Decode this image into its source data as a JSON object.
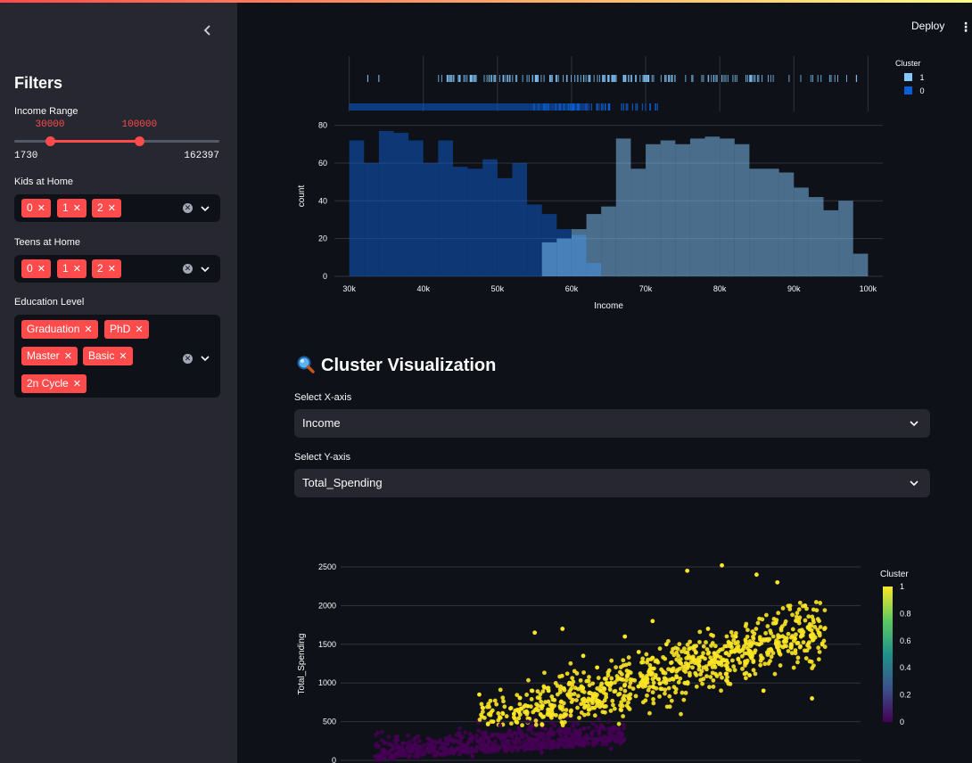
{
  "app": {
    "deploy_label": "Deploy",
    "menu_icon": "kebab-menu-icon"
  },
  "sidebar": {
    "collapse_icon": "chevron-left-icon",
    "title": "Filters",
    "income_range": {
      "label": "Income Range",
      "low": "30000",
      "high": "100000",
      "min": "1730",
      "max": "162397",
      "low_frac": 0.174,
      "high_frac": 0.61
    },
    "kids": {
      "label": "Kids at Home",
      "tags": [
        "0",
        "1",
        "2"
      ]
    },
    "teens": {
      "label": "Teens at Home",
      "tags": [
        "0",
        "1",
        "2"
      ]
    },
    "education": {
      "label": "Education Level",
      "tags": [
        "Graduation",
        "PhD",
        "Master",
        "Basic",
        "2n Cycle"
      ]
    }
  },
  "main": {
    "section_title": "Cluster Visualization",
    "section_icon": "magnifier-icon",
    "x_select": {
      "label": "Select X-axis",
      "value": "Income"
    },
    "y_select": {
      "label": "Select Y-axis",
      "value": "Total_Spending"
    }
  },
  "colors": {
    "accent": "#ff4b4b",
    "cluster0": "#0b5fd4",
    "cluster1": "#83c9ff"
  },
  "chart_data": [
    {
      "type": "bar",
      "subtype": "overlaid histogram with rug plot",
      "xlabel": "Income",
      "ylabel": "count",
      "xlim": [
        28000,
        102000
      ],
      "ylim": [
        0,
        85
      ],
      "x_ticks": [
        "30k",
        "40k",
        "50k",
        "60k",
        "70k",
        "80k",
        "90k",
        "100k"
      ],
      "y_ticks": [
        "0",
        "20",
        "40",
        "60",
        "80"
      ],
      "legend": {
        "title": "Cluster",
        "entries": [
          "1",
          "0"
        ],
        "position": "top-right"
      },
      "bin_width": 2000,
      "bin_starts": [
        30000,
        32000,
        34000,
        36000,
        38000,
        40000,
        42000,
        44000,
        46000,
        48000,
        50000,
        52000,
        54000,
        56000,
        58000,
        60000,
        62000,
        64000,
        66000,
        68000,
        70000,
        72000,
        74000,
        76000,
        78000,
        80000,
        82000,
        84000,
        86000,
        88000,
        90000,
        92000,
        94000,
        96000,
        98000
      ],
      "series": [
        {
          "name": "0",
          "values": [
            72,
            60,
            77,
            76,
            72,
            60,
            72,
            58,
            57,
            62,
            52,
            60,
            38,
            33,
            25,
            22,
            7,
            0,
            0,
            0,
            0,
            0,
            0,
            0,
            0,
            0,
            0,
            0,
            0,
            0,
            0,
            0,
            0,
            0,
            0
          ]
        },
        {
          "name": "1",
          "values": [
            0,
            0,
            0,
            0,
            0,
            0,
            0,
            0,
            0,
            0,
            0,
            0,
            0,
            18,
            20,
            25,
            33,
            37,
            73,
            57,
            70,
            72,
            70,
            73,
            74,
            73,
            70,
            57,
            57,
            55,
            47,
            42,
            35,
            40,
            12
          ]
        }
      ],
      "rug": {
        "cluster1_range": [
          42000,
          99000
        ],
        "cluster0_range": [
          30000,
          72000
        ]
      }
    },
    {
      "type": "scatter",
      "xlabel": "Income",
      "ylabel": "Total_Spending",
      "ylim": [
        0,
        2600
      ],
      "y_ticks": [
        "0",
        "500",
        "1000",
        "1500",
        "2000",
        "2500"
      ],
      "colorbar": {
        "title": "Cluster",
        "ticks": [
          "1",
          "0.8",
          "0.6",
          "0.4",
          "0.2",
          "0"
        ],
        "colorscale": "viridis"
      },
      "series": [
        {
          "cluster": 1,
          "color": "#fde725",
          "points": [
            [
              60000,
              1350
            ],
            [
              75000,
              2450
            ],
            [
              80000,
              2520
            ],
            [
              85000,
              2400
            ],
            [
              88000,
              2300
            ],
            [
              92000,
              2000
            ],
            [
              70000,
              1800
            ],
            [
              66000,
              1600
            ],
            [
              62000,
              1200
            ],
            [
              58000,
              1000
            ],
            [
              55000,
              900
            ],
            [
              52000,
              700
            ],
            [
              50000,
              600
            ],
            [
              64000,
              1000
            ],
            [
              68000,
              1400
            ],
            [
              72000,
              1500
            ],
            [
              76000,
              1300
            ],
            [
              78000,
              1700
            ],
            [
              82000,
              1600
            ],
            [
              84000,
              1100
            ],
            [
              86000,
              900
            ],
            [
              90000,
              1500
            ],
            [
              93000,
              800
            ],
            [
              45000,
              850
            ],
            [
              47000,
              500
            ],
            [
              53000,
              1650
            ],
            [
              57000,
              1700
            ]
          ]
        },
        {
          "cluster": 0,
          "color": "#440154",
          "points": [
            [
              30000,
              50
            ],
            [
              34000,
              120
            ],
            [
              38000,
              200
            ],
            [
              42000,
              150
            ],
            [
              46000,
              300
            ],
            [
              50000,
              250
            ],
            [
              55000,
              350
            ],
            [
              60000,
              200
            ],
            [
              64000,
              150
            ],
            [
              36000,
              60
            ],
            [
              40000,
              100
            ],
            [
              48000,
              450
            ],
            [
              52000,
              500
            ],
            [
              58000,
              400
            ],
            [
              44000,
              50
            ],
            [
              54000,
              100
            ]
          ]
        }
      ]
    }
  ]
}
